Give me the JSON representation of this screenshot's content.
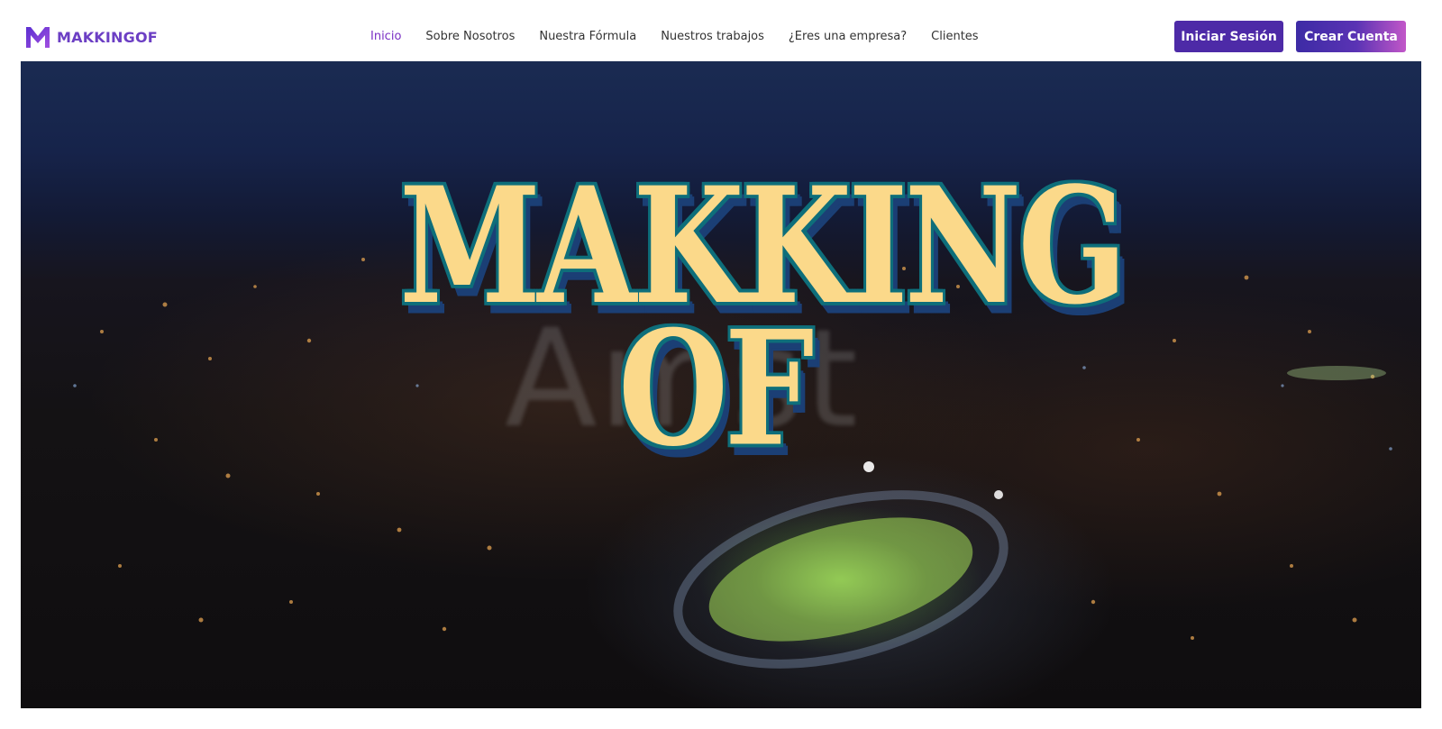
{
  "header": {
    "logo_text": "MAKKINGOF",
    "nav": [
      {
        "label": "Inicio",
        "active": true
      },
      {
        "label": "Sobre Nosotros",
        "active": false
      },
      {
        "label": "Nuestra Fórmula",
        "active": false
      },
      {
        "label": "Nuestros trabajos",
        "active": false
      },
      {
        "label": "¿Eres una empresa?",
        "active": false
      },
      {
        "label": "Clientes",
        "active": false
      }
    ],
    "login_label": "Iniciar Sesión",
    "register_label": "Crear Cuenta"
  },
  "hero": {
    "title_line_1": "MAKKING",
    "title_line_2": "OF",
    "background_watermark": "Amst"
  },
  "colors": {
    "brand_purple": "#6c3fc4",
    "nav_active": "#7a2fc4",
    "login_button": "#4d2aa7",
    "register_gradient_start": "#3d2ba5",
    "register_gradient_end": "#c257c8",
    "title_fill": "#fbd98a",
    "title_outline": "#0e6e7a",
    "title_shadow": "#1b3f75"
  },
  "icons": {
    "logo": "makkingof-m-logo-icon"
  }
}
